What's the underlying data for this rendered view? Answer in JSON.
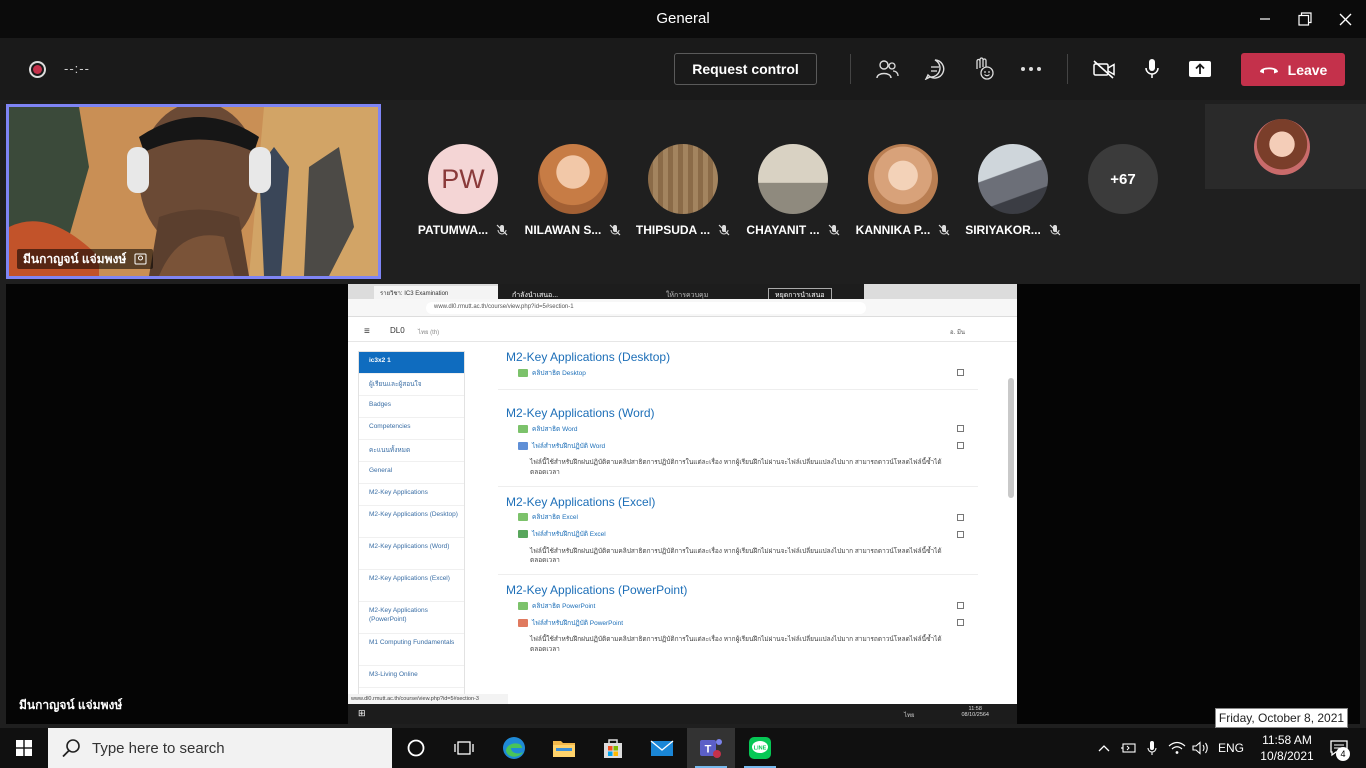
{
  "window": {
    "title": "General"
  },
  "toolbar": {
    "timer": "--:--",
    "request_control_label": "Request control",
    "leave_label": "Leave",
    "colors": {
      "leave": "#c4314b",
      "accent": "#7f85f5"
    }
  },
  "self_video": {
    "name": "มีนกาญจน์ แจ่มพงษ์"
  },
  "participants": [
    {
      "name": "PATUMWA...",
      "initials": "PW"
    },
    {
      "name": "NILAWAN S..."
    },
    {
      "name": "THIPSUDA ..."
    },
    {
      "name": "CHAYANIT ..."
    },
    {
      "name": "KANNIKA P..."
    },
    {
      "name": "SIRIYAKOR..."
    }
  ],
  "overflow_count": "+67",
  "shared_screen": {
    "presenter_name": "มีนกาญจน์ แจ่มพงษ์",
    "tab_label": "รายวิชา: IC3 Examination",
    "presenting_label": "กำลังนำเสนอ...",
    "give_control_label": "ให้การควบคุม",
    "stop_presenting_label": "หยุดการนำเสนอ",
    "url": "www.dl0.rmutt.ac.th/course/view.php?id=5#section-1",
    "site_name": "DL0",
    "language": "ไทย (th)",
    "user_label": "อ. มีน",
    "sidebar": [
      "ic3x2 1",
      "ผู้เรียนและผู้สอนใจ",
      "Badges",
      "Competencies",
      "คะแนนทั้งหมด",
      "General",
      "M2-Key Applications",
      "M2-Key Applications (Desktop)",
      "M2-Key Applications (Word)",
      "M2-Key Applications (Excel)",
      "M2-Key Applications (PowerPoint)",
      "M1 Computing Fundamentals",
      "M3-Living Online"
    ],
    "sections": [
      {
        "title": "M2-Key Applications (Desktop)",
        "activities": [
          "คลิปสาธิต Desktop"
        ]
      },
      {
        "title": "M2-Key Applications (Word)",
        "activities": [
          "คลิปสาธิต Word",
          "ไฟล์สำหรับฝึกปฏิบัติ Word"
        ],
        "note": "ไฟล์นี้ใช้สำหรับฝึกฝนปฏิบัติตามคลิปสาธิตการปฏิบัติการในแต่ละเรื่อง หากผู้เรียนฝึกไม่ผ่านจะไฟล์เปลี่ยนแปลงไปมาก สามารถดาวน์โหลดไฟล์นี้ซ้ำได้ตลอดเวลา"
      },
      {
        "title": "M2-Key Applications (Excel)",
        "activities": [
          "คลิปสาธิต Excel",
          "ไฟล์สำหรับฝึกปฏิบัติ Excel"
        ],
        "note": "ไฟล์นี้ใช้สำหรับฝึกฝนปฏิบัติตามคลิปสาธิตการปฏิบัติการในแต่ละเรื่อง หากผู้เรียนฝึกไม่ผ่านจะไฟล์เปลี่ยนแปลงไปมาก สามารถดาวน์โหลดไฟล์นี้ซ้ำได้ตลอดเวลา"
      },
      {
        "title": "M2-Key Applications (PowerPoint)",
        "activities": [
          "คลิปสาธิต PowerPoint",
          "ไฟล์สำหรับฝึกปฏิบัติ PowerPoint"
        ],
        "note": "ไฟล์นี้ใช้สำหรับฝึกฝนปฏิบัติตามคลิปสาธิตการปฏิบัติการในแต่ละเรื่อง หากผู้เรียนฝึกไม่ผ่านจะไฟล์เปลี่ยนแปลงไปมาก สามารถดาวน์โหลดไฟล์นี้ซ้ำได้ตลอดเวลา"
      }
    ],
    "status_url": "www.dl0.rmutt.ac.th/course/view.php?id=5#section-3",
    "inner_clock_time": "11:58",
    "inner_clock_date": "08/10/2564",
    "inner_lang": "ไทย"
  },
  "tooltip": "Friday, October 8, 2021",
  "taskbar": {
    "search_placeholder": "Type here to search",
    "lang": "ENG",
    "time": "11:58 AM",
    "date": "10/8/2021",
    "notification_count": "4"
  }
}
